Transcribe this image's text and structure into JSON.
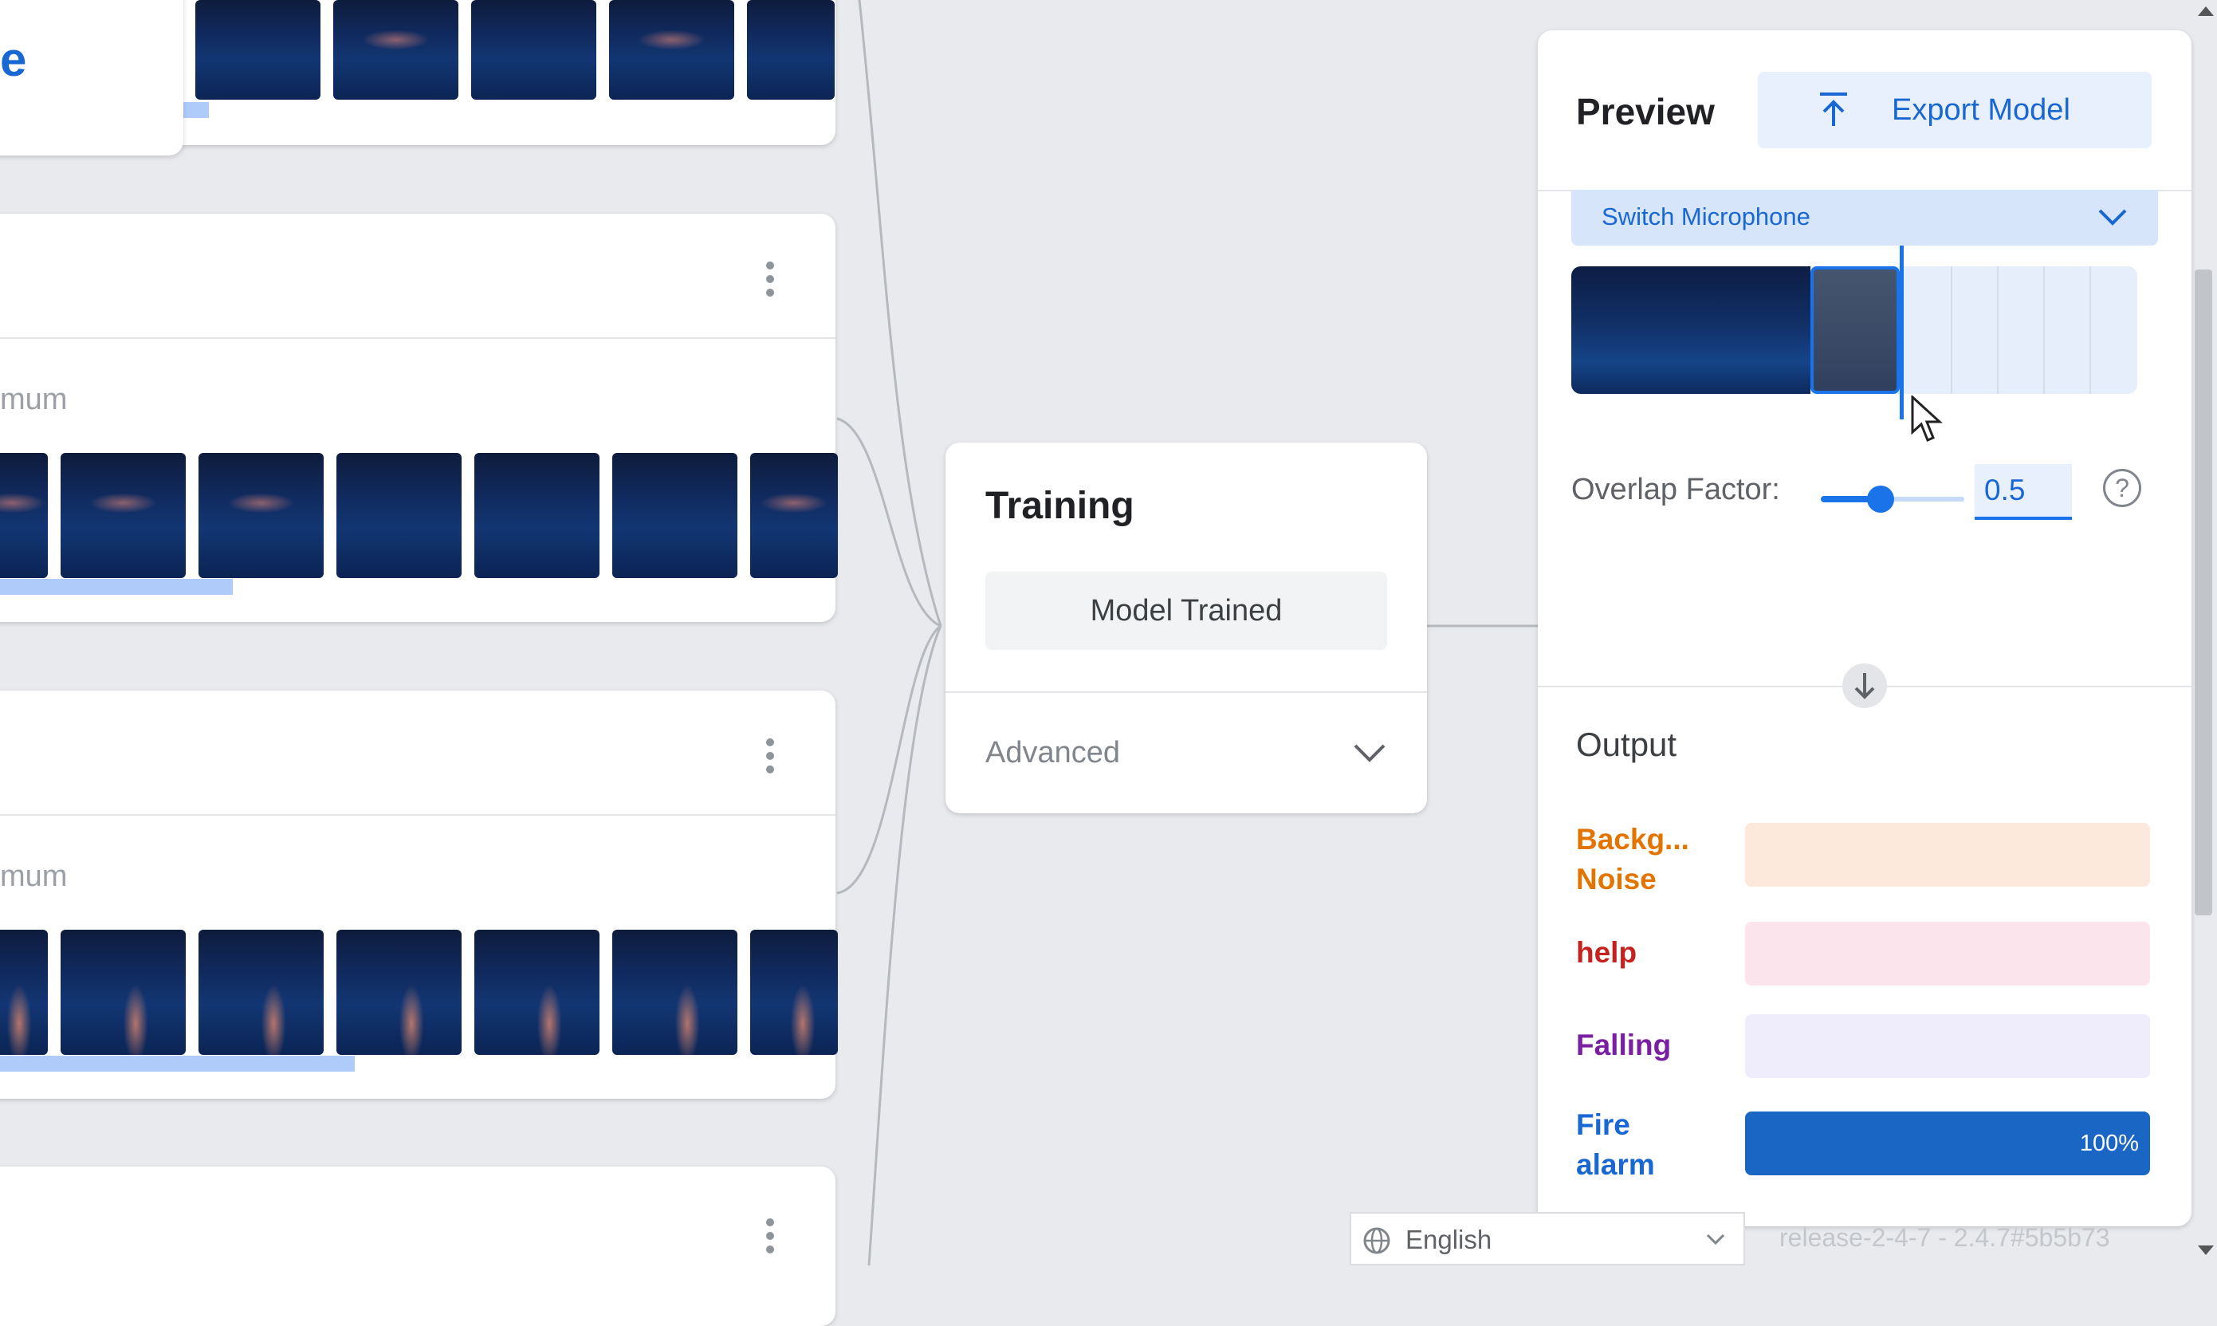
{
  "left_panel": {
    "title_fragment": "e",
    "min_label_1": "mum",
    "min_label_2": "mum"
  },
  "training": {
    "title": "Training",
    "status_button": "Model Trained",
    "advanced_label": "Advanced"
  },
  "preview": {
    "title": "Preview",
    "export_button": "Export Model",
    "switch_mic": "Switch Microphone",
    "overlap_label": "Overlap Factor:",
    "overlap_value": "0.5",
    "overlap_level": 0.5,
    "help_glyph": "?",
    "output_title": "Output",
    "outputs": [
      {
        "label": "Backg... Noise",
        "color": "#e37400",
        "track": "#fde8dc",
        "fill": 0
      },
      {
        "label": "help",
        "color": "#c5221f",
        "track": "#fce4ec",
        "fill": 0
      },
      {
        "label": "Falling",
        "color": "#7b1fa2",
        "track": "#efecfb",
        "fill": 0
      },
      {
        "label": "Fire alarm",
        "color": "#1967d2",
        "track": "#1a66c5",
        "fill": 1.0,
        "value": "100%"
      }
    ]
  },
  "footer": {
    "language": "English",
    "version": "release-2-4-7 - 2.4.7#5b5b73"
  },
  "icons": [
    "more-vert-icon",
    "chevron-down-icon",
    "upload-icon",
    "arrow-down-icon",
    "help-icon",
    "globe-icon",
    "cursor-icon"
  ]
}
